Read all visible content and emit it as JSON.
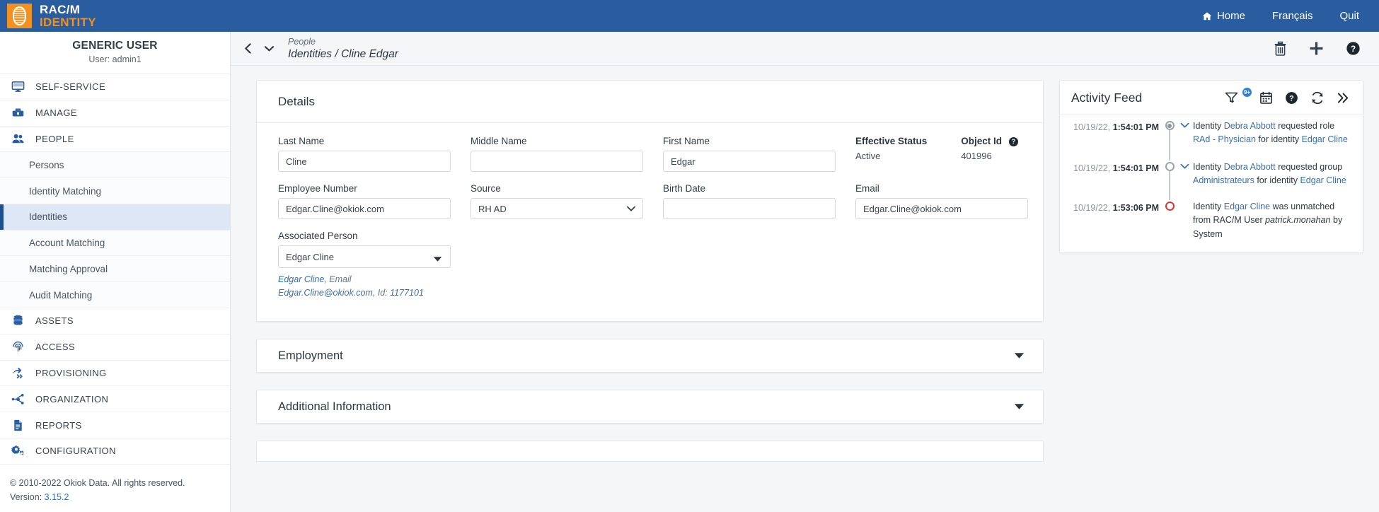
{
  "topbar": {
    "brand_line1": "RAC/M",
    "brand_line2": "IDENTITY",
    "nav": [
      {
        "label": "Home",
        "icon": "home-icon"
      },
      {
        "label": "Français",
        "icon": ""
      },
      {
        "label": "Quit",
        "icon": ""
      }
    ]
  },
  "sidebar": {
    "user_name": "GENERIC USER",
    "user_sub": "User: admin1",
    "groups": [
      {
        "label": "SELF-SERVICE",
        "icon": "monitor-icon"
      },
      {
        "label": "MANAGE",
        "icon": "toolbox-icon"
      },
      {
        "label": "PEOPLE",
        "icon": "people-icon"
      }
    ],
    "people_items": [
      {
        "label": "Persons",
        "active": false
      },
      {
        "label": "Identity Matching",
        "active": false
      },
      {
        "label": "Identities",
        "active": true
      },
      {
        "label": "Account Matching",
        "active": false
      },
      {
        "label": "Matching Approval",
        "active": false
      },
      {
        "label": "Audit Matching",
        "active": false
      }
    ],
    "groups2": [
      {
        "label": "ASSETS",
        "icon": "database-icon"
      },
      {
        "label": "ACCESS",
        "icon": "fingerprint-icon"
      },
      {
        "label": "PROVISIONING",
        "icon": "arrows-icon"
      },
      {
        "label": "ORGANIZATION",
        "icon": "network-icon"
      },
      {
        "label": "REPORTS",
        "icon": "document-icon"
      },
      {
        "label": "CONFIGURATION",
        "icon": "gears-icon"
      }
    ],
    "footer_copyright": "© 2010-2022 Okiok Data. All rights reserved.",
    "footer_version_label": "Version:",
    "footer_version_value": "3.15.2"
  },
  "breadcrumb": {
    "parent": "People",
    "current": "Identities / Cline Edgar",
    "actions": [
      {
        "name": "delete-icon"
      },
      {
        "name": "add-icon"
      },
      {
        "name": "help-icon"
      }
    ]
  },
  "details": {
    "title": "Details",
    "last_name": {
      "label": "Last Name",
      "value": "Cline"
    },
    "middle_name": {
      "label": "Middle Name",
      "value": ""
    },
    "first_name": {
      "label": "First Name",
      "value": "Edgar"
    },
    "effective_status": {
      "label": "Effective Status",
      "value": "Active"
    },
    "object_id": {
      "label": "Object Id",
      "value": "401996"
    },
    "employee_number": {
      "label": "Employee Number",
      "value": "Edgar.Cline@okiok.com"
    },
    "source": {
      "label": "Source",
      "value": "RH AD",
      "options": [
        "RH AD"
      ]
    },
    "birth_date": {
      "label": "Birth Date",
      "value": ""
    },
    "email": {
      "label": "Email",
      "value": "Edgar.Cline@okiok.com"
    },
    "associated_person": {
      "label": "Associated Person",
      "value": "Edgar Cline",
      "link_name": "Edgar Cline",
      "link_mid": ", Email ",
      "link_email": "Edgar.Cline@okiok.com",
      "link_id_label": ", Id: ",
      "link_id_value": "1177101"
    }
  },
  "sections": [
    {
      "title": "Employment",
      "expanded": false
    },
    {
      "title": "Additional Information",
      "expanded": false
    }
  ],
  "activity_feed": {
    "title": "Activity Feed",
    "badge": "9+",
    "icons": [
      {
        "name": "filter-icon"
      },
      {
        "name": "calendar-icon"
      },
      {
        "name": "help-icon"
      },
      {
        "name": "refresh-icon"
      },
      {
        "name": "collapse-icon"
      }
    ],
    "items": [
      {
        "date": "10/19/22, ",
        "time": "1:54:01 PM",
        "marker": "filled",
        "has_chevron": true,
        "parts": [
          {
            "t": "Identity ",
            "k": "plain"
          },
          {
            "t": "Debra Abbott",
            "k": "link"
          },
          {
            "t": " requested role ",
            "k": "plain"
          },
          {
            "t": "RAd - Physician",
            "k": "link"
          },
          {
            "t": " for identity ",
            "k": "plain"
          },
          {
            "t": "Edgar Cline",
            "k": "link"
          }
        ]
      },
      {
        "date": "10/19/22, ",
        "time": "1:54:01 PM",
        "marker": "hollow",
        "has_chevron": true,
        "parts": [
          {
            "t": "Identity ",
            "k": "plain"
          },
          {
            "t": "Debra Abbott",
            "k": "link"
          },
          {
            "t": " requested group ",
            "k": "plain"
          },
          {
            "t": "Administrateurs",
            "k": "link"
          },
          {
            "t": " for identity ",
            "k": "plain"
          },
          {
            "t": "Edgar Cline",
            "k": "link"
          }
        ]
      },
      {
        "date": "10/19/22, ",
        "time": "1:53:06 PM",
        "marker": "red",
        "has_chevron": false,
        "parts": [
          {
            "t": "Identity ",
            "k": "plain"
          },
          {
            "t": "Edgar Cline",
            "k": "link"
          },
          {
            "t": " was unmatched from RAC/M User ",
            "k": "plain"
          },
          {
            "t": "patrick.monahan",
            "k": "italic"
          },
          {
            "t": " by System",
            "k": "plain"
          }
        ]
      }
    ]
  }
}
